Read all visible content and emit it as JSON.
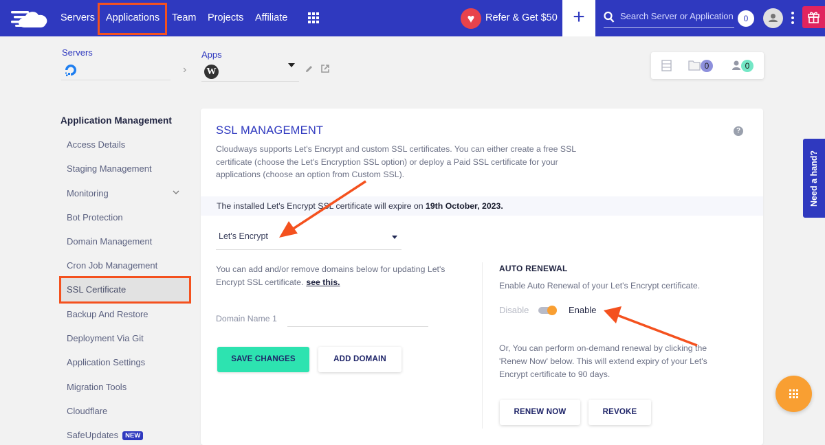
{
  "topbar": {
    "nav": [
      "Servers",
      "Applications",
      "Team",
      "Projects",
      "Affiliate"
    ],
    "active_nav": "Applications",
    "refer_label": "Refer & Get $50",
    "add_label": "+",
    "search_placeholder": "Search Server or Application",
    "notification_count": "0",
    "colors": {
      "bar": "#2f39bf",
      "highlight": "#f4511e",
      "gift": "#e0245e"
    }
  },
  "breadcrumb": {
    "servers_label": "Servers",
    "apps_label": "Apps",
    "server_value": "",
    "app_value": ""
  },
  "quick_links": {
    "files_count": "0",
    "users_count": "0"
  },
  "sidebar": {
    "title": "Application Management",
    "items": [
      {
        "label": "Access Details"
      },
      {
        "label": "Staging Management"
      },
      {
        "label": "Monitoring",
        "has_submenu": true
      },
      {
        "label": "Bot Protection"
      },
      {
        "label": "Domain Management"
      },
      {
        "label": "Cron Job Management"
      },
      {
        "label": "SSL Certificate",
        "active": true
      },
      {
        "label": "Backup And Restore"
      },
      {
        "label": "Deployment Via Git"
      },
      {
        "label": "Application Settings"
      },
      {
        "label": "Migration Tools"
      },
      {
        "label": "Cloudflare"
      },
      {
        "label": "SafeUpdates",
        "badge": "NEW"
      }
    ]
  },
  "ssl": {
    "title": "SSL MANAGEMENT",
    "description": "Cloudways supports Let's Encrypt and custom SSL certificates. You can either create a free SSL certificate (choose the Let's Encryption SSL option) or deploy a Paid SSL certificate for your applications (choose an option from Custom SSL).",
    "expire_prefix": "The installed Let's Encrypt SSL certificate will expire on ",
    "expire_date": "19th October, 2023.",
    "provider_selected": "Let's Encrypt",
    "domains_desc": "You can add and/or remove domains below for updating Let's Encrypt SSL certificate.",
    "see_this": "see this.",
    "domain_label": "Domain Name 1",
    "domain_value": "",
    "save_label": "SAVE CHANGES",
    "add_domain_label": "ADD DOMAIN",
    "auto_renewal": {
      "title": "AUTO RENEWAL",
      "desc": "Enable Auto Renewal of your Let's Encrypt certificate.",
      "off_label": "Disable",
      "on_label": "Enable",
      "enabled": true,
      "ondemand_desc": "Or, You can perform on-demand renewal by clicking the 'Renew Now' below. This will extend expiry of your Let's Encrypt certificate to 90 days.",
      "renew_label": "RENEW NOW",
      "revoke_label": "REVOKE"
    }
  },
  "help_tab": "Need a hand?"
}
